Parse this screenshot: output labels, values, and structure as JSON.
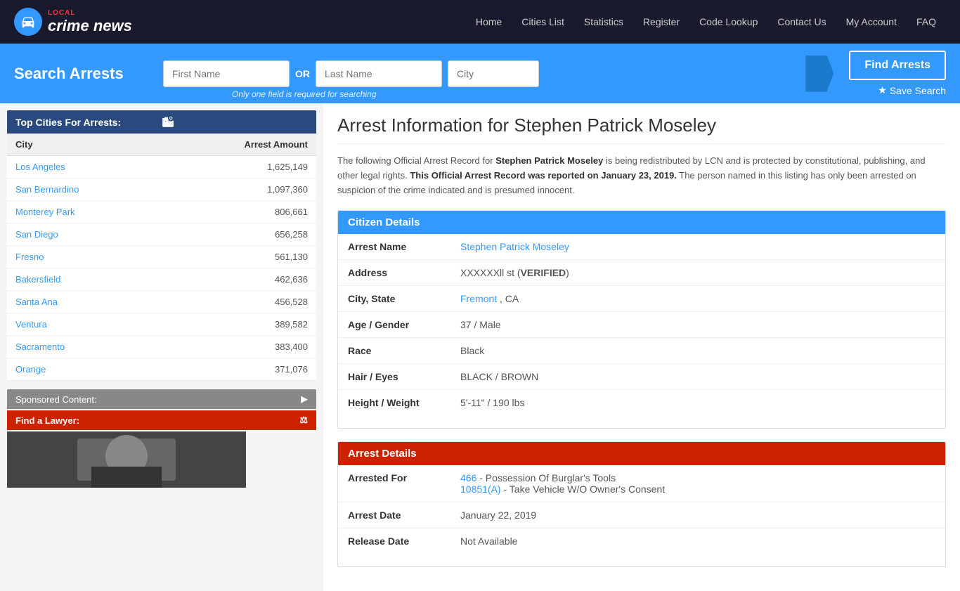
{
  "nav": {
    "brand": "crime news",
    "brand_local": "LOCAL",
    "links": [
      "Home",
      "Cities List",
      "Statistics",
      "Register",
      "Code Lookup",
      "Contact Us",
      "My Account",
      "FAQ"
    ]
  },
  "search": {
    "title": "Search Arrests",
    "first_name_placeholder": "First Name",
    "last_name_placeholder": "Last Name",
    "city_placeholder": "City",
    "or_text": "OR",
    "hint": "Only one field is required for searching",
    "find_btn": "Find Arrests",
    "save_btn": "Save Search"
  },
  "sidebar": {
    "top_cities_header": "Top Cities For Arrests:",
    "col_city": "City",
    "col_amount": "Arrest Amount",
    "cities": [
      {
        "name": "Los Angeles",
        "amount": "1,625,149"
      },
      {
        "name": "San Bernardino",
        "amount": "1,097,360"
      },
      {
        "name": "Monterey Park",
        "amount": "806,661"
      },
      {
        "name": "San Diego",
        "amount": "656,258"
      },
      {
        "name": "Fresno",
        "amount": "561,130"
      },
      {
        "name": "Bakersfield",
        "amount": "462,636"
      },
      {
        "name": "Santa Ana",
        "amount": "456,528"
      },
      {
        "name": "Ventura",
        "amount": "389,582"
      },
      {
        "name": "Sacramento",
        "amount": "383,400"
      },
      {
        "name": "Orange",
        "amount": "371,076"
      }
    ],
    "sponsored_header": "Sponsored Content:",
    "find_lawyer": "Find a Lawyer:"
  },
  "arrest": {
    "page_title": "Arrest Information for Stephen Patrick Moseley",
    "intro_text": "The following Official Arrest Record for",
    "subject_name": "Stephen Patrick Moseley",
    "intro_text2": "is being redistributed by LCN and is protected by constitutional, publishing, and other legal rights.",
    "report_date_text": "This Official Arrest Record was reported on January 23, 2019.",
    "intro_text3": "The person named in this listing has only been arrested on suspicion of the crime indicated and is presumed innocent.",
    "citizen_details_header": "Citizen Details",
    "arrest_details_header": "Arrest Details",
    "fields": {
      "arrest_name_label": "Arrest Name",
      "arrest_name_value": "Stephen Patrick Moseley",
      "address_label": "Address",
      "address_value": "XXXXXXll st",
      "address_verified": "VERIFIED",
      "city_state_label": "City, State",
      "city_value": "Fremont",
      "state_value": ", CA",
      "age_gender_label": "Age / Gender",
      "age_gender_value": "37 / Male",
      "race_label": "Race",
      "race_value": "Black",
      "hair_eyes_label": "Hair / Eyes",
      "hair_eyes_value": "BLACK / BROWN",
      "height_weight_label": "Height / Weight",
      "height_weight_value": "5'-11\" / 190 lbs"
    },
    "arrest_fields": {
      "arrested_for_label": "Arrested For",
      "charge1_code": "466",
      "charge1_desc": " - Possession Of Burglar's Tools",
      "charge2_code": "10851(A)",
      "charge2_desc": " - Take Vehicle W/O Owner's Consent",
      "arrest_date_label": "Arrest Date",
      "arrest_date_value": "January 22, 2019",
      "release_date_label": "Release Date",
      "release_date_value": "Not Available"
    }
  }
}
